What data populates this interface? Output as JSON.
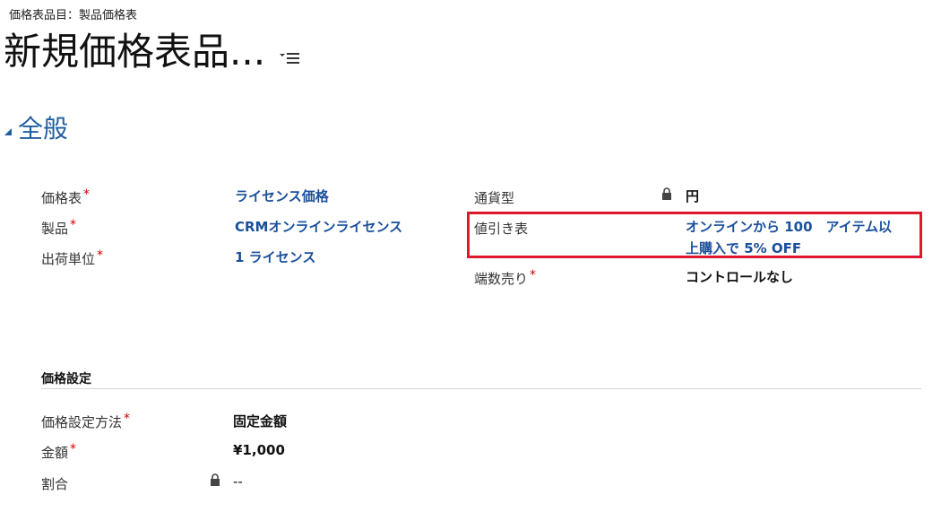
{
  "header": {
    "entity_type": "価格表品目：製品価格表",
    "title": "新規価格表品..."
  },
  "section": {
    "title": "全般"
  },
  "fields": {
    "price_list": {
      "label": "価格表",
      "value": "ライセンス価格"
    },
    "product": {
      "label": "製品",
      "value": "CRMオンラインライセンス"
    },
    "unit": {
      "label": "出荷単位",
      "value": "1 ライセンス"
    },
    "currency": {
      "label": "通貨型",
      "value": "円"
    },
    "discount_list": {
      "label": "値引き表",
      "value_line1": "オンラインから 100　アイテム以",
      "value_line2": "上購入で 5% OFF"
    },
    "rounding": {
      "label": "端数売り",
      "value": "コントロールなし"
    }
  },
  "pricing": {
    "header": "価格設定",
    "method": {
      "label": "価格設定方法",
      "value": "固定金額"
    },
    "amount": {
      "label": "金額",
      "value": "¥1,000"
    },
    "percentage": {
      "label": "割合",
      "value": "--"
    }
  },
  "required_marker": "*",
  "colors": {
    "link": "#1a4f9c",
    "section_title": "#1f5f9f",
    "required": "#d40000",
    "highlight": "#e0182d"
  },
  "icons": {
    "title_menu": "menu-icon",
    "section_toggle": "collapse-triangle-icon",
    "lock": "lock-icon"
  }
}
